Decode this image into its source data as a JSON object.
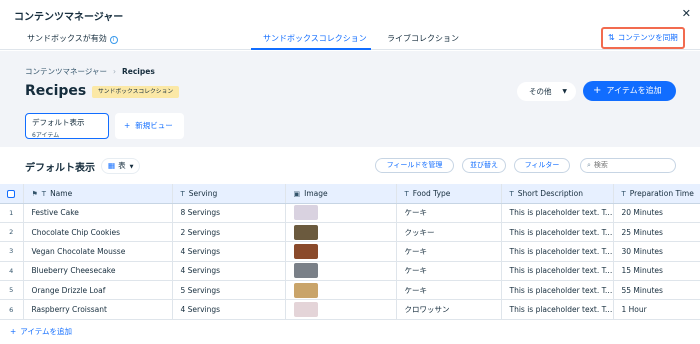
{
  "window": {
    "title": "コンテンツマネージャー",
    "close_icon": "close-icon"
  },
  "topnav": {
    "sandbox_status": "サンドボックスが有効",
    "info_icon": "i",
    "tabs": [
      {
        "label": "サンドボックスコレクション",
        "active": true
      },
      {
        "label": "ライブコレクション",
        "active": false
      }
    ],
    "sync_button": "コンテンツを同期",
    "sync_icon": "sync-icon"
  },
  "breadcrumb": {
    "root": "コンテンツマネージャー",
    "separator": "›",
    "current": "Recipes"
  },
  "page": {
    "title": "Recipes",
    "badge": "サンドボックスコレクション",
    "more_button": "その他",
    "add_item_button": "アイテムを追加"
  },
  "views": {
    "current_name": "デフォルト表示",
    "current_count": "6アイテム",
    "new_view_button": "新規ビュー"
  },
  "toolbar": {
    "view_title": "デフォルト表示",
    "table_toggle": "表",
    "manage_fields": "フィールドを管理",
    "sort": "並び替え",
    "filter": "フィルター",
    "search_placeholder": "検索"
  },
  "table": {
    "columns": [
      {
        "label": "Name",
        "icon": "T"
      },
      {
        "label": "Serving",
        "icon": "T"
      },
      {
        "label": "Image",
        "icon": "image"
      },
      {
        "label": "Food Type",
        "icon": "T"
      },
      {
        "label": "Short Description",
        "icon": "T"
      },
      {
        "label": "Preparation Time",
        "icon": "T"
      }
    ],
    "rows": [
      {
        "num": "1",
        "name": "Festive Cake",
        "serving": "8 Servings",
        "thumb_color": "#d9d2e0",
        "food_type": "ケーキ",
        "description": "This is placeholder text. To...",
        "prep_time": "20 Minutes"
      },
      {
        "num": "2",
        "name": "Chocolate Chip Cookies",
        "serving": "2 Servings",
        "thumb_color": "#6b5a3e",
        "food_type": "クッキー",
        "description": "This is placeholder text. To...",
        "prep_time": "25 Minutes"
      },
      {
        "num": "3",
        "name": "Vegan Chocolate Mousse",
        "serving": "4 Servings",
        "thumb_color": "#8a4a2b",
        "food_type": "ケーキ",
        "description": "This is placeholder text. To...",
        "prep_time": "30 Minutes"
      },
      {
        "num": "4",
        "name": "Blueberry Cheesecake",
        "serving": "4 Servings",
        "thumb_color": "#7a8088",
        "food_type": "ケーキ",
        "description": "This is placeholder text. To...",
        "prep_time": "15 Minutes"
      },
      {
        "num": "5",
        "name": "Orange Drizzle Loaf",
        "serving": "5 Servings",
        "thumb_color": "#c9a46a",
        "food_type": "ケーキ",
        "description": "This is placeholder text. To...",
        "prep_time": "55 Minutes"
      },
      {
        "num": "6",
        "name": "Raspberry Croissant",
        "serving": "4 Servings",
        "thumb_color": "#e4d4d8",
        "food_type": "クロワッサン",
        "description": "This is placeholder text. To...",
        "prep_time": "1 Hour"
      }
    ],
    "add_row": "アイテムを追加"
  },
  "colors": {
    "accent": "#116dff",
    "highlight": "#f26b4f",
    "badge": "#fbe8a6"
  }
}
